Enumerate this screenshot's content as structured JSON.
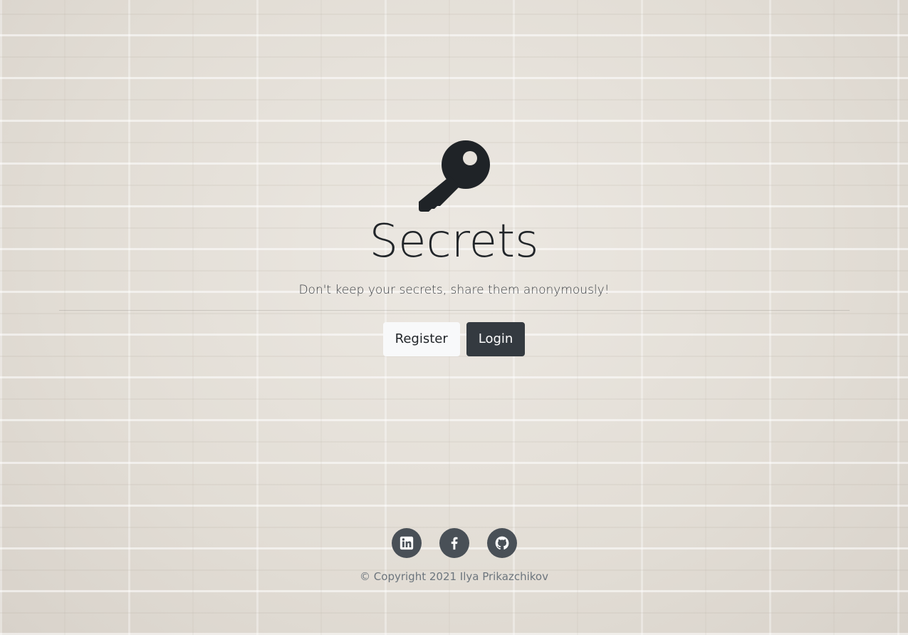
{
  "hero": {
    "icon": "key-icon",
    "title": "Secrets",
    "lead": "Don't keep your secrets, share them anonymously!"
  },
  "buttons": {
    "register_label": "Register",
    "login_label": "Login"
  },
  "footer": {
    "social": [
      {
        "name": "linkedin-icon"
      },
      {
        "name": "facebook-icon"
      },
      {
        "name": "github-icon"
      }
    ],
    "copyright": "© Copyright 2021 Ilya Prikazchikov"
  },
  "colors": {
    "text": "#212529",
    "button_light": "#f8f9fa",
    "button_dark": "#343a40",
    "social_bg": "#495057",
    "muted": "#6c757d"
  }
}
